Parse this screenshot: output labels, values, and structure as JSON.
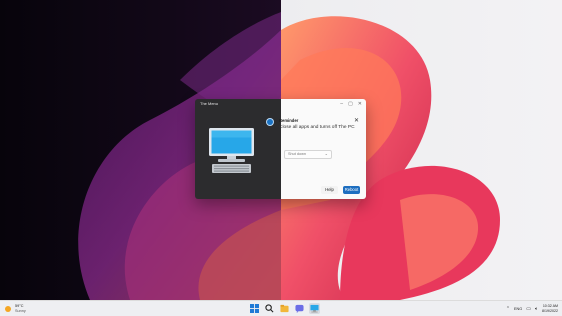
{
  "window": {
    "title": "The Menu"
  },
  "reminder": {
    "title": "Reminder",
    "message": "Close all apps and turns off The PC"
  },
  "action_select": {
    "selected": "Shut down"
  },
  "buttons": {
    "help": "Help",
    "reboot": "Reboot"
  },
  "taskbar": {
    "weather": {
      "temperature": "59°C",
      "condition": "Sunny"
    },
    "language": "ENG",
    "time": "10:32 AM",
    "date": "8/19/2022"
  },
  "icons": {
    "window_controls": [
      "minimize-icon",
      "maximize-icon",
      "close-icon"
    ],
    "taskbar_apps": [
      "start-icon",
      "search-icon",
      "file-explorer-icon",
      "chat-icon",
      "the-menu-app-icon"
    ],
    "tray": [
      "display-icon",
      "speaker-icon"
    ]
  },
  "colors": {
    "accent": "#1d6ec0",
    "dialog_dark": "#2c2c2e",
    "dialog_light": "#fafafa",
    "taskbar": "#eeeff2"
  }
}
